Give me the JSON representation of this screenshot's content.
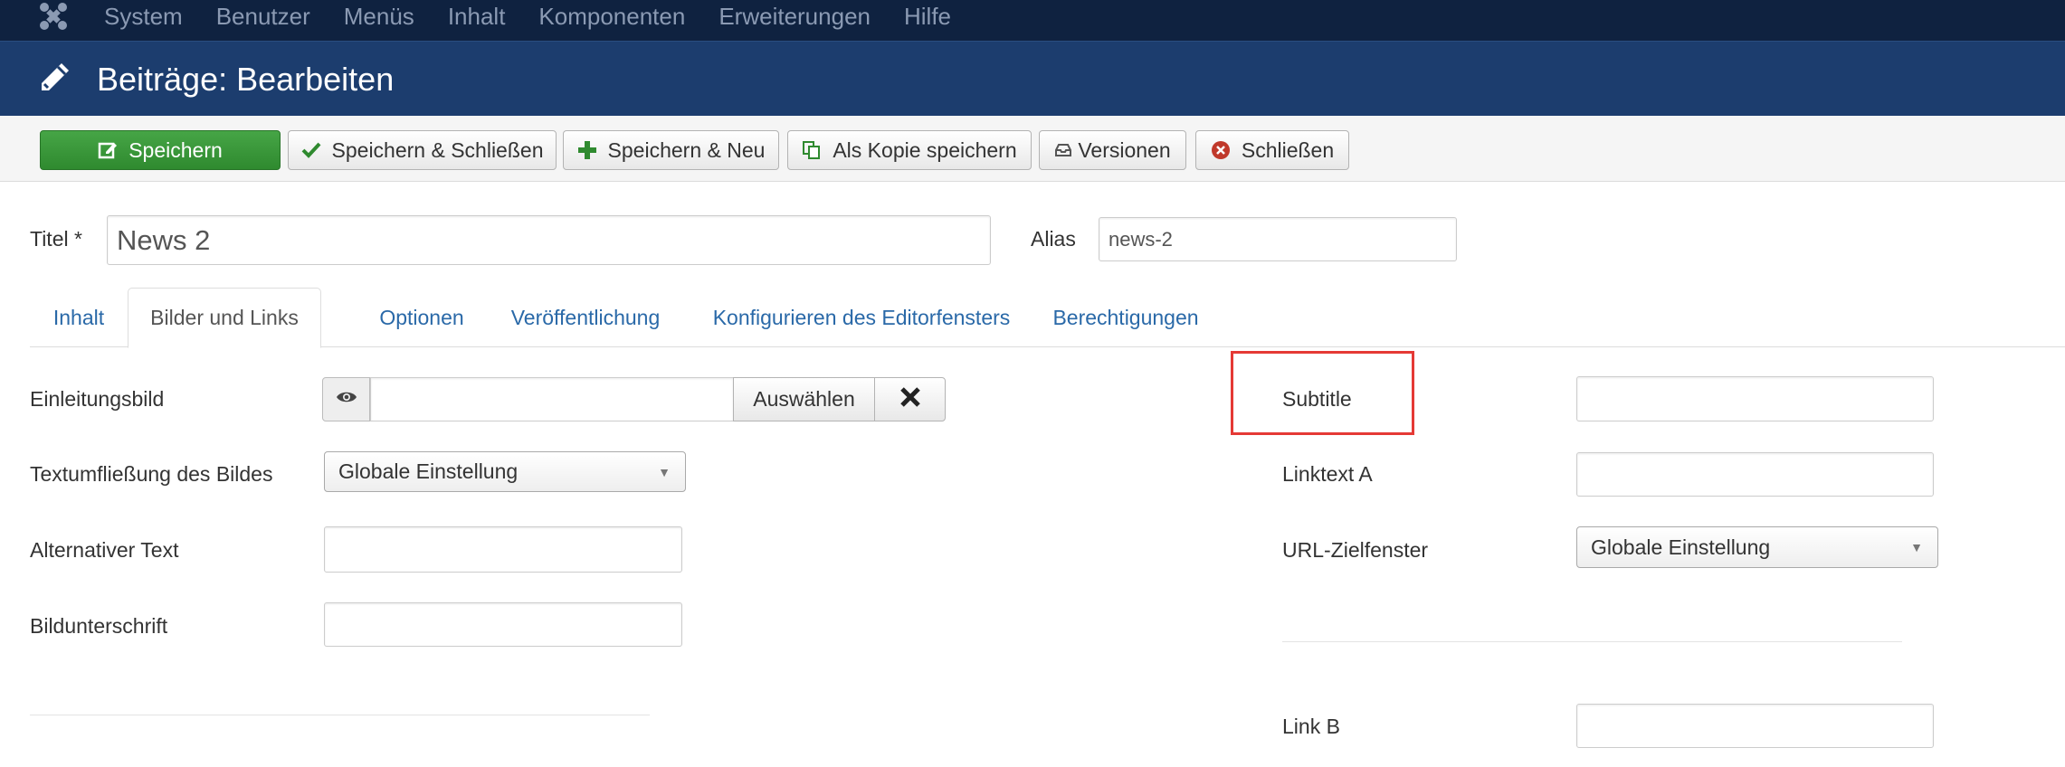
{
  "topnav": {
    "logo_icon": "joomla-logo-icon",
    "items": [
      "System",
      "Benutzer",
      "Menüs",
      "Inhalt",
      "Komponenten",
      "Erweiterungen",
      "Hilfe"
    ]
  },
  "header": {
    "icon": "pencil-icon",
    "title": "Beiträge: Bearbeiten"
  },
  "toolbar": {
    "save": "Speichern",
    "save_close": "Speichern & Schließen",
    "save_new": "Speichern & Neu",
    "save_copy": "Als Kopie speichern",
    "versions": "Versionen",
    "close": "Schließen"
  },
  "form": {
    "title_label": "Titel *",
    "title_value": "News 2",
    "alias_label": "Alias",
    "alias_value": "news-2"
  },
  "tabs": [
    "Inhalt",
    "Bilder und Links",
    "Optionen",
    "Veröffentlichung",
    "Konfigurieren des Editorfensters",
    "Berechtigungen"
  ],
  "active_tab": "Bilder und Links",
  "left_fields": {
    "intro_image_label": "Einleitungsbild",
    "select_button": "Auswählen",
    "float_label": "Textumfließung des Bildes",
    "float_value": "Globale Einstellung",
    "alt_label": "Alternativer Text",
    "caption_label": "Bildunterschrift"
  },
  "right_fields": {
    "subtitle_label": "Subtitle",
    "linktext_a_label": "Linktext A",
    "url_target_label": "URL-Zielfenster",
    "url_target_value": "Globale Einstellung",
    "link_b_label": "Link B"
  },
  "colors": {
    "topnav_bg": "#0f2240",
    "header_bg": "#1c3d6e",
    "primary_btn": "#46a546",
    "link_blue": "#2a69a8",
    "highlight_red": "#e53935"
  }
}
